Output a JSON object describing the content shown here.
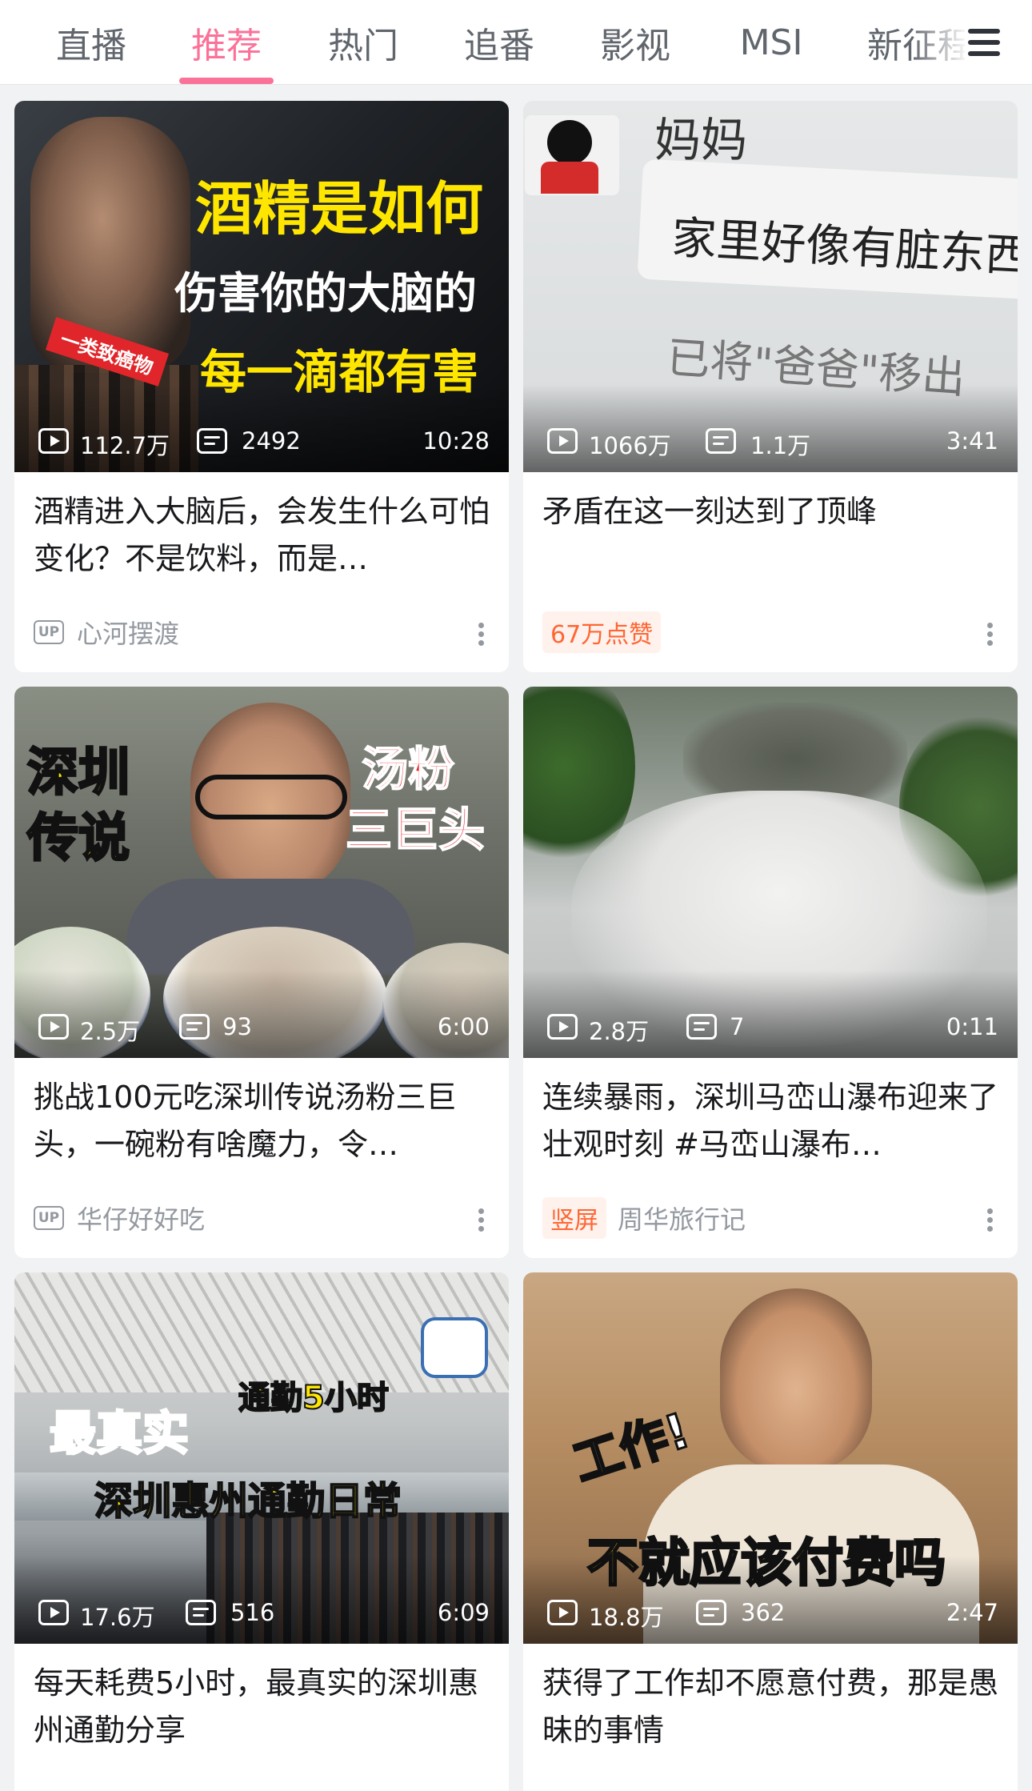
{
  "tabs": [
    {
      "label": "直播",
      "active": false
    },
    {
      "label": "推荐",
      "active": true
    },
    {
      "label": "热门",
      "active": false
    },
    {
      "label": "追番",
      "active": false
    },
    {
      "label": "影视",
      "active": false
    },
    {
      "label": "MSI",
      "active": false
    },
    {
      "label": "新征程",
      "active": false
    }
  ],
  "menu_icon": "hamburger-menu-icon",
  "accent_color": "#fb7299",
  "up_badge_text": "UP",
  "cards": [
    {
      "views": "112.7万",
      "danmaku": "2492",
      "duration": "10:28",
      "title": "酒精进入大脑后，会发生什么可怕变化？不是饮料，而是…",
      "author": "心河摆渡",
      "tag": "",
      "thumb_text": {
        "line1": "酒精是如何",
        "line2": "伤害你的大脑的",
        "line3": "每一滴都有害",
        "ribbon": "一类致癌物"
      }
    },
    {
      "views": "1066万",
      "danmaku": "1.1万",
      "duration": "3:41",
      "title": "矛盾在这一刻达到了顶峰",
      "author": "",
      "tag": "67万点赞",
      "thumb_text": {
        "sender": "妈妈",
        "message": "家里好像有脏东西",
        "notice": "已将\"爸爸\"移出"
      }
    },
    {
      "views": "2.5万",
      "danmaku": "93",
      "duration": "6:00",
      "title": "挑战100元吃深圳传说汤粉三巨头，一碗粉有啥魔力，令…",
      "author": "华仔好好吃",
      "tag": "",
      "thumb_text": {
        "left1": "深圳",
        "left2": "传说",
        "right1": "汤粉",
        "right2": "三巨头"
      }
    },
    {
      "views": "2.8万",
      "danmaku": "7",
      "duration": "0:11",
      "title": "连续暴雨，深圳马峦山瀑布迎来了壮观时刻 #马峦山瀑布…",
      "author": "周华旅行记",
      "tag": "竖屏",
      "thumb_text": {}
    },
    {
      "views": "17.6万",
      "danmaku": "516",
      "duration": "6:09",
      "title": "每天耗费5小时，最真实的深圳惠州通勤分享",
      "author": "",
      "tag": "",
      "thumb_text": {
        "left": "最真实",
        "top": "通勤5小时",
        "banner": "深圳惠州通勤日常"
      }
    },
    {
      "views": "18.8万",
      "danmaku": "362",
      "duration": "2:47",
      "title": "获得了工作却不愿意付费，那是愚昧的事情",
      "author": "",
      "tag": "",
      "thumb_text": {
        "top": "工作!",
        "bottom": "不就应该付费吗"
      }
    }
  ]
}
